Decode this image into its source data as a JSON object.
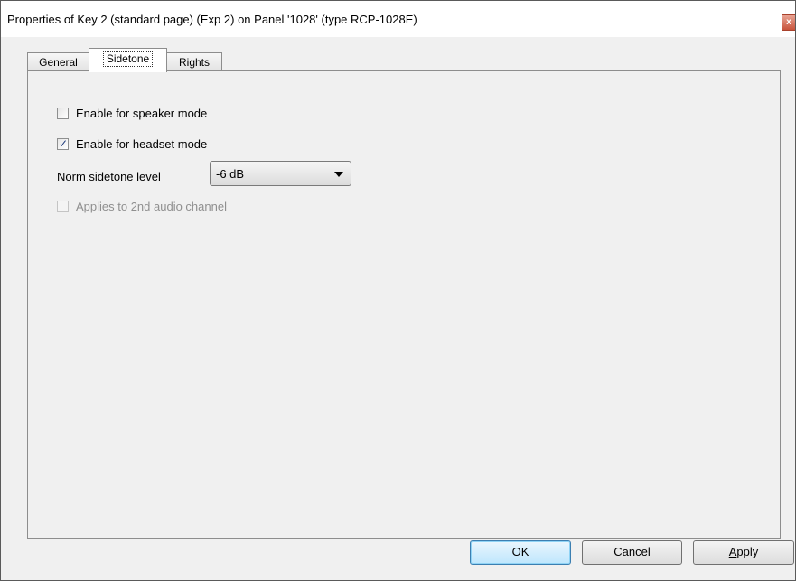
{
  "window": {
    "title": "Properties of Key 2 (standard page) (Exp 2) on Panel '1028' (type RCP-1028E)",
    "close_glyph": "x"
  },
  "tabs": [
    {
      "label": "General",
      "active": false
    },
    {
      "label": "Sidetone",
      "active": true
    },
    {
      "label": "Rights",
      "active": false
    }
  ],
  "sidetone": {
    "speaker_mode": {
      "label": "Enable for speaker mode",
      "checked": false
    },
    "headset_mode": {
      "label": "Enable for headset mode",
      "checked": true
    },
    "norm_level": {
      "label": "Norm sidetone level",
      "value": "-6 dB"
    },
    "second_channel": {
      "label": "Applies to 2nd audio channel",
      "checked": false,
      "disabled": true
    }
  },
  "buttons": {
    "ok": "OK",
    "cancel": "Cancel",
    "apply_prefix": "A",
    "apply_rest": "pply"
  }
}
